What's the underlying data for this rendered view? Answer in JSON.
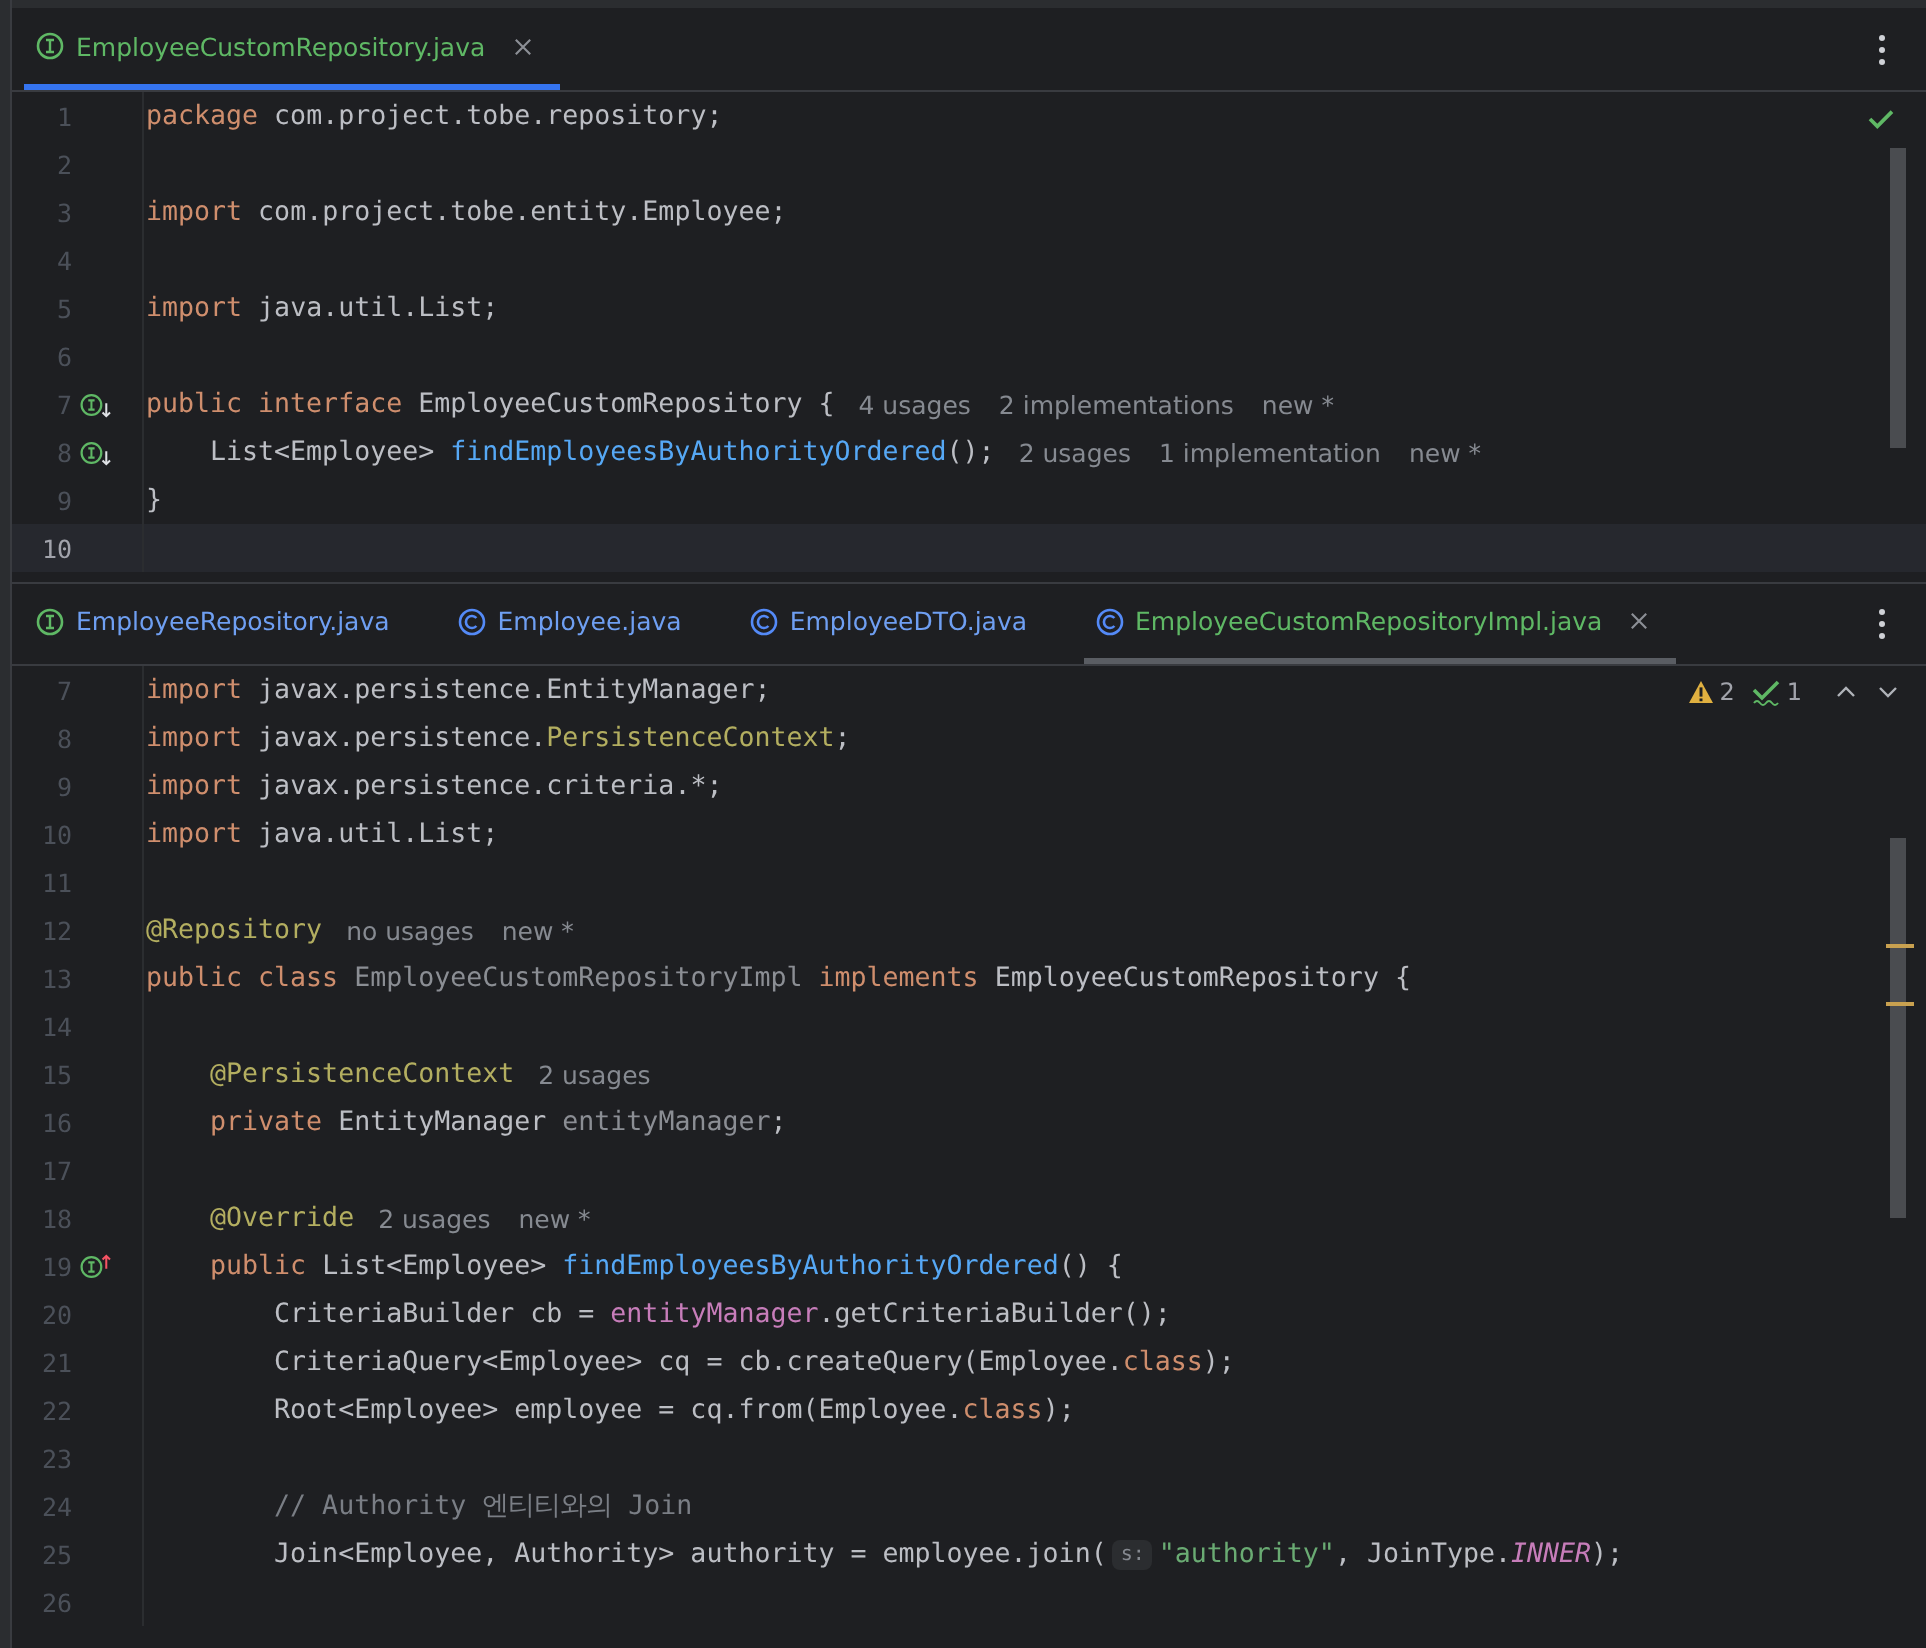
{
  "panes": [
    {
      "focused": true,
      "kind": "ok",
      "tabs": [
        {
          "label": "EmployeeCustomRepository.java",
          "kind": "interface",
          "color": "#5fb865",
          "selected": true
        }
      ],
      "lines": [
        {
          "number": "1",
          "segments": [
            {
              "kind": "code",
              "tokens": [
                {
                  "kind": "keyword",
                  "text": "package"
                },
                {
                  "kind": "plain",
                  "text": " com.project.tobe.repository;"
                }
              ]
            }
          ]
        },
        {
          "number": "2"
        },
        {
          "number": "3",
          "segments": [
            {
              "kind": "code",
              "tokens": [
                {
                  "kind": "keyword",
                  "text": "import"
                },
                {
                  "kind": "plain",
                  "text": " com.project.tobe.entity.Employee;"
                }
              ]
            }
          ]
        },
        {
          "number": "4"
        },
        {
          "number": "5",
          "segments": [
            {
              "kind": "code",
              "tokens": [
                {
                  "kind": "keyword",
                  "text": "import"
                },
                {
                  "kind": "plain",
                  "text": " java.util.List;"
                }
              ]
            }
          ]
        },
        {
          "number": "6"
        },
        {
          "number": "7",
          "marker": {
            "kind": "implemented"
          },
          "segments": [
            {
              "kind": "code",
              "tokens": [
                {
                  "kind": "keyword",
                  "text": "public interface"
                },
                {
                  "kind": "plain",
                  "text": " EmployeeCustomRepository {"
                }
              ]
            },
            {
              "kind": "hint",
              "text": "4 usages"
            },
            {
              "kind": "hint",
              "text": "2 implementations"
            },
            {
              "kind": "hint",
              "text": "new *"
            }
          ]
        },
        {
          "number": "8",
          "marker": {
            "kind": "implemented"
          },
          "segments": [
            {
              "kind": "code",
              "tokens": [
                {
                  "kind": "plain",
                  "text": "    List<Employee> "
                },
                {
                  "kind": "method",
                  "text": "findEmployeesByAuthorityOrdered"
                },
                {
                  "kind": "plain",
                  "text": "();"
                }
              ]
            },
            {
              "kind": "hint",
              "text": "2 usages"
            },
            {
              "kind": "hint",
              "text": "1 implementation"
            },
            {
              "kind": "hint",
              "text": "new *"
            }
          ]
        },
        {
          "number": "9",
          "segments": [
            {
              "kind": "code",
              "tokens": [
                {
                  "kind": "plain",
                  "text": "}"
                }
              ]
            }
          ]
        },
        {
          "number": "10",
          "current": true
        }
      ]
    },
    {
      "focused": false,
      "kind": "problems",
      "warnings": "2",
      "weak_warnings": "1",
      "tabs": [
        {
          "label": "EmployeeRepository.java",
          "kind": "interface",
          "color": "#6f9ff2",
          "selected": false
        },
        {
          "label": "Employee.java",
          "kind": "class",
          "color": "#6f9ff2",
          "selected": false
        },
        {
          "label": "EmployeeDTO.java",
          "kind": "class",
          "color": "#6f9ff2",
          "selected": false
        },
        {
          "label": "EmployeeCustomRepositoryImpl.java",
          "kind": "class",
          "color": "#5fb865",
          "selected": true
        }
      ],
      "lines": [
        {
          "number": "7",
          "segments": [
            {
              "kind": "code",
              "tokens": [
                {
                  "kind": "keyword",
                  "text": "import"
                },
                {
                  "kind": "plain",
                  "text": " javax.persistence.EntityManager;"
                }
              ]
            }
          ]
        },
        {
          "number": "8",
          "segments": [
            {
              "kind": "code",
              "tokens": [
                {
                  "kind": "keyword",
                  "text": "import"
                },
                {
                  "kind": "plain",
                  "text": " javax.persistence."
                },
                {
                  "kind": "annotation",
                  "text": "PersistenceContext"
                },
                {
                  "kind": "plain",
                  "text": ";"
                }
              ]
            }
          ]
        },
        {
          "number": "9",
          "segments": [
            {
              "kind": "code",
              "tokens": [
                {
                  "kind": "keyword",
                  "text": "import"
                },
                {
                  "kind": "plain",
                  "text": " javax.persistence.criteria.*;"
                }
              ]
            }
          ]
        },
        {
          "number": "10",
          "segments": [
            {
              "kind": "code",
              "tokens": [
                {
                  "kind": "keyword",
                  "text": "import"
                },
                {
                  "kind": "plain",
                  "text": " java.util.List;"
                }
              ]
            }
          ]
        },
        {
          "number": "11"
        },
        {
          "number": "12",
          "segments": [
            {
              "kind": "code",
              "tokens": [
                {
                  "kind": "annotation",
                  "text": "@Repository"
                }
              ]
            },
            {
              "kind": "hint",
              "text": "no usages"
            },
            {
              "kind": "hint",
              "text": "new *"
            }
          ]
        },
        {
          "number": "13",
          "segments": [
            {
              "kind": "code",
              "tokens": [
                {
                  "kind": "keyword",
                  "text": "public class"
                },
                {
                  "kind": "unused",
                  "text": " EmployeeCustomRepositoryImpl"
                },
                {
                  "kind": "keyword",
                  "text": " implements"
                },
                {
                  "kind": "plain",
                  "text": " EmployeeCustomRepository {"
                }
              ]
            }
          ]
        },
        {
          "number": "14"
        },
        {
          "number": "15",
          "segments": [
            {
              "kind": "code",
              "tokens": [
                {
                  "kind": "annotation",
                  "text": "    @PersistenceContext"
                }
              ]
            },
            {
              "kind": "hint",
              "text": "2 usages"
            }
          ]
        },
        {
          "number": "16",
          "segments": [
            {
              "kind": "code",
              "tokens": [
                {
                  "kind": "keyword",
                  "text": "    private"
                },
                {
                  "kind": "plain",
                  "text": " EntityManager "
                },
                {
                  "kind": "unused",
                  "text": "entityManager"
                },
                {
                  "kind": "plain",
                  "text": ";"
                }
              ]
            }
          ]
        },
        {
          "number": "17"
        },
        {
          "number": "18",
          "segments": [
            {
              "kind": "code",
              "tokens": [
                {
                  "kind": "annotation",
                  "text": "    @Override"
                }
              ]
            },
            {
              "kind": "hint",
              "text": "2 usages"
            },
            {
              "kind": "hint",
              "text": "new *"
            }
          ]
        },
        {
          "number": "19",
          "marker": {
            "kind": "implements"
          },
          "segments": [
            {
              "kind": "code",
              "tokens": [
                {
                  "kind": "keyword",
                  "text": "    public"
                },
                {
                  "kind": "plain",
                  "text": " List<Employee> "
                },
                {
                  "kind": "method",
                  "text": "findEmployeesByAuthorityOrdered"
                },
                {
                  "kind": "plain",
                  "text": "() {"
                }
              ]
            }
          ]
        },
        {
          "number": "20",
          "segments": [
            {
              "kind": "code",
              "tokens": [
                {
                  "kind": "plain",
                  "text": "        CriteriaBuilder cb = "
                },
                {
                  "kind": "field",
                  "text": "entityManager"
                },
                {
                  "kind": "plain",
                  "text": ".getCriteriaBuilder();"
                }
              ]
            }
          ]
        },
        {
          "number": "21",
          "segments": [
            {
              "kind": "code",
              "tokens": [
                {
                  "kind": "plain",
                  "text": "        CriteriaQuery<Employee> cq = cb.createQuery(Employee."
                },
                {
                  "kind": "keyword",
                  "text": "class"
                },
                {
                  "kind": "plain",
                  "text": ");"
                }
              ]
            }
          ]
        },
        {
          "number": "22",
          "segments": [
            {
              "kind": "code",
              "tokens": [
                {
                  "kind": "plain",
                  "text": "        Root<Employee> employee = cq.from(Employee."
                },
                {
                  "kind": "keyword",
                  "text": "class"
                },
                {
                  "kind": "plain",
                  "text": ");"
                }
              ]
            }
          ]
        },
        {
          "number": "23"
        },
        {
          "number": "24",
          "segments": [
            {
              "kind": "code",
              "tokens": [
                {
                  "kind": "comment",
                  "text": "        // Authority 엔티티와의 Join"
                }
              ]
            }
          ]
        },
        {
          "number": "25",
          "segments": [
            {
              "kind": "code",
              "tokens": [
                {
                  "kind": "plain",
                  "text": "        Join<Employee, Authority> authority = employee.join("
                }
              ]
            },
            {
              "kind": "param",
              "text": "s:"
            },
            {
              "kind": "code",
              "tokens": [
                {
                  "kind": "string",
                  "text": "\"authority\""
                },
                {
                  "kind": "plain",
                  "text": ", JoinType."
                },
                {
                  "kind": "constant",
                  "text": "INNER"
                },
                {
                  "kind": "plain",
                  "text": ");"
                }
              ]
            }
          ]
        },
        {
          "number": "26"
        }
      ]
    }
  ]
}
